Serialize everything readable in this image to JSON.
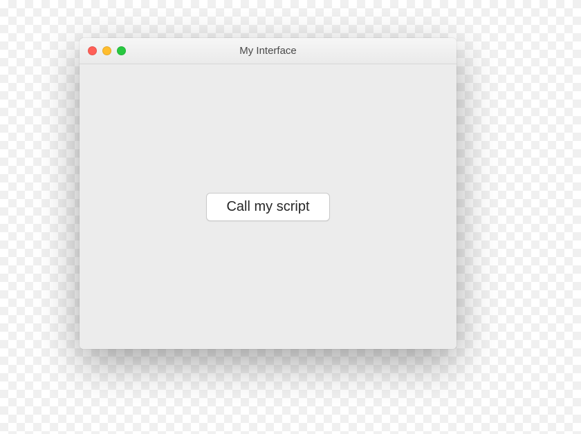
{
  "window": {
    "title": "My Interface"
  },
  "body": {
    "button_label": "Call my script"
  }
}
